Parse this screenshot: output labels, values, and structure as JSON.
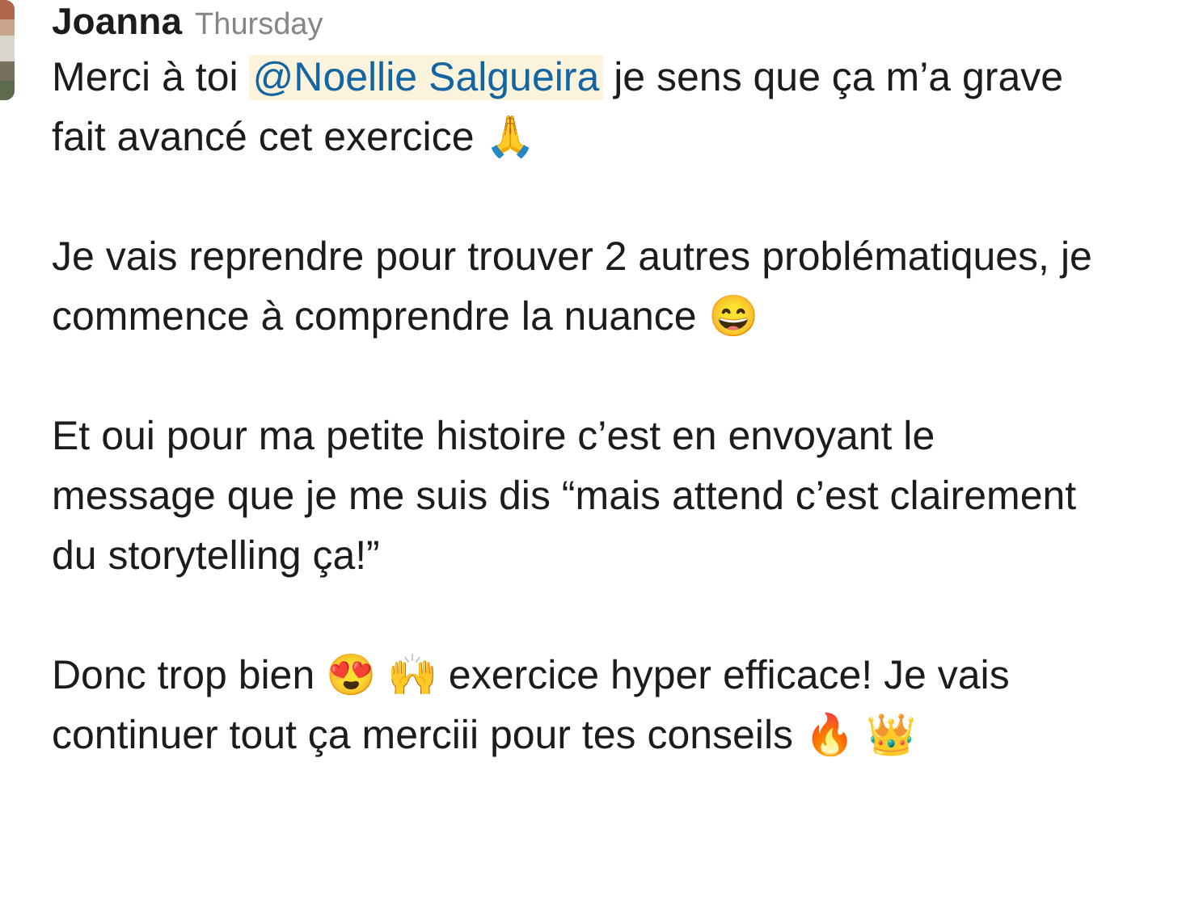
{
  "message": {
    "author": "Joanna",
    "time": "Thursday",
    "paragraphs": [
      {
        "segments": [
          {
            "kind": "text",
            "text": "Merci à toi "
          },
          {
            "kind": "mention",
            "text": "@Noellie Salgueira"
          },
          {
            "kind": "text",
            "text": " je sens que ça m’a grave fait avancé cet exercice 🙏"
          }
        ]
      },
      {
        "segments": [
          {
            "kind": "text",
            "text": "Je vais reprendre pour trouver 2 autres problématiques, je commence à comprendre la nuance 😄"
          }
        ]
      },
      {
        "segments": [
          {
            "kind": "text",
            "text": "Et oui pour ma petite histoire c’est en envoyant le message que je me suis dis “mais attend c’est clairement du storytelling ça!”"
          }
        ]
      },
      {
        "segments": [
          {
            "kind": "text",
            "text": "Donc trop bien 😍 🙌 exercice hyper efficace! Je vais continuer tout ça merciii pour tes conseils 🔥 👑"
          }
        ]
      }
    ]
  }
}
